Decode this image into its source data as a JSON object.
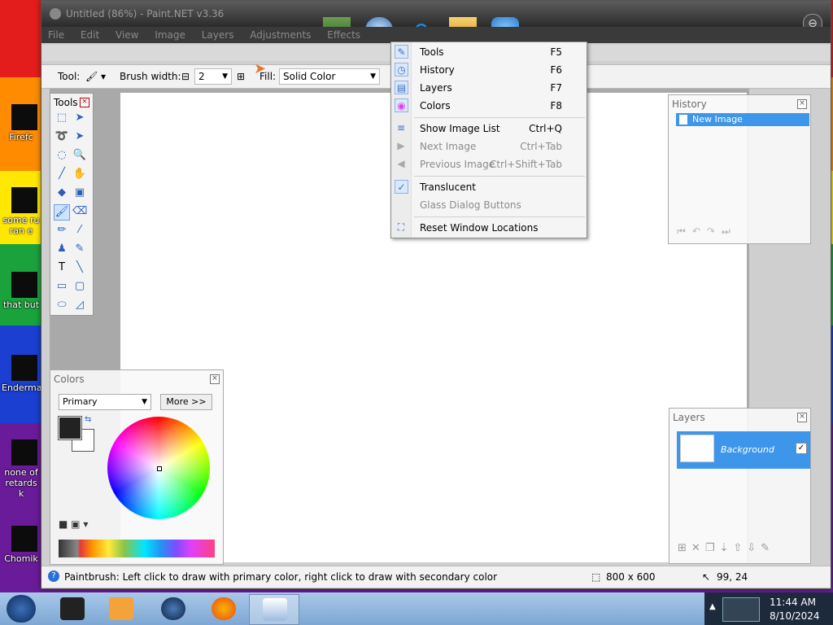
{
  "desktop": {
    "icons": [
      {
        "label": "Firefc"
      },
      {
        "label": "some ru\nran e"
      },
      {
        "label": "that but"
      },
      {
        "label": "Enderma"
      },
      {
        "label": "none of\nretards k"
      },
      {
        "label": "Chomik"
      }
    ]
  },
  "window": {
    "title": "Untitled (86%) - Paint.NET v3.36",
    "menu": [
      "File",
      "Edit",
      "View",
      "Image",
      "Layers",
      "Adjustments",
      "Effects"
    ]
  },
  "toolbar": {
    "tool_label": "Tool:",
    "brush_width_label": "Brush width:",
    "brush_width_value": "2",
    "fill_label": "Fill:",
    "fill_value": "Solid Color"
  },
  "tools_panel": {
    "title": "Tools"
  },
  "history_panel": {
    "title": "History",
    "items": [
      "New Image"
    ]
  },
  "layers_panel": {
    "title": "Layers",
    "layers": [
      {
        "name": "Background",
        "visible": true
      }
    ]
  },
  "colors_panel": {
    "title": "Colors",
    "mode": "Primary",
    "more_label": "More >>",
    "primary_color": "#222222",
    "secondary_color": "#ffffff"
  },
  "window_menu": {
    "items": [
      {
        "label": "Tools",
        "key": "F5",
        "icon": "tools-icon",
        "enabled": true
      },
      {
        "label": "History",
        "key": "F6",
        "icon": "clock-icon",
        "enabled": true
      },
      {
        "label": "Layers",
        "key": "F7",
        "icon": "layers-icon",
        "enabled": true
      },
      {
        "label": "Colors",
        "key": "F8",
        "icon": "color-wheel-icon",
        "enabled": true
      },
      {
        "label": "Show Image List",
        "key": "Ctrl+Q",
        "icon": "image-list-icon",
        "enabled": true
      },
      {
        "label": "Next Image",
        "key": "Ctrl+Tab",
        "icon": "next-image-icon",
        "enabled": false
      },
      {
        "label": "Previous Image",
        "key": "Ctrl+Shift+Tab",
        "icon": "previous-image-icon",
        "enabled": false
      },
      {
        "label": "Translucent",
        "key": "",
        "icon": "check-icon",
        "enabled": true,
        "checked": true
      },
      {
        "label": "Glass Dialog Buttons",
        "key": "",
        "icon": "",
        "enabled": false
      },
      {
        "label": "Reset Window Locations",
        "key": "",
        "icon": "reset-windows-icon",
        "enabled": true
      }
    ]
  },
  "statusbar": {
    "hint": "Paintbrush: Left click to draw with primary color, right click to draw with secondary color",
    "image_size": "800 x 600",
    "cursor_pos": "99, 24"
  },
  "taskbar": {
    "time": "11:44 AM",
    "date": "8/10/2024"
  },
  "colors": {
    "selection": "#3d96ea",
    "accent_blue": "#2a6ed8"
  }
}
